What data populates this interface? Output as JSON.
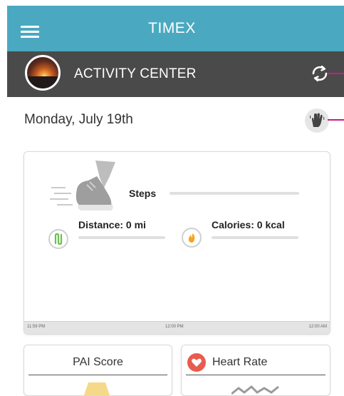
{
  "app": {
    "title": "TIMEX"
  },
  "activity_bar": {
    "title": "ACTIVITY CENTER"
  },
  "date": "Monday, July 19th",
  "summary": {
    "steps_label": "Steps",
    "distance_label": "Distance: 0 mi",
    "calories_label": "Calories: 0 kcal"
  },
  "timeline": {
    "start": "11:59 PM",
    "middle": "12:00 PM",
    "end": "12:00 AM"
  },
  "cards": {
    "pai_title": "PAI Score",
    "hr_title": "Heart Rate"
  },
  "colors": {
    "header": "#4aa9c0",
    "activity_bar": "#4a4a4a",
    "accent_pink": "#d0178a",
    "distance_icon": "#6cc04a",
    "calories_icon": "#f3a71c",
    "heart_badge": "#e85b4f"
  },
  "icons": {
    "menu": "hamburger-icon",
    "sync": "sync-icon",
    "wave": "hand-wave-icon",
    "steps": "sneaker-icon",
    "distance": "distance-icon",
    "calories": "flame-icon",
    "heart": "heart-icon"
  }
}
